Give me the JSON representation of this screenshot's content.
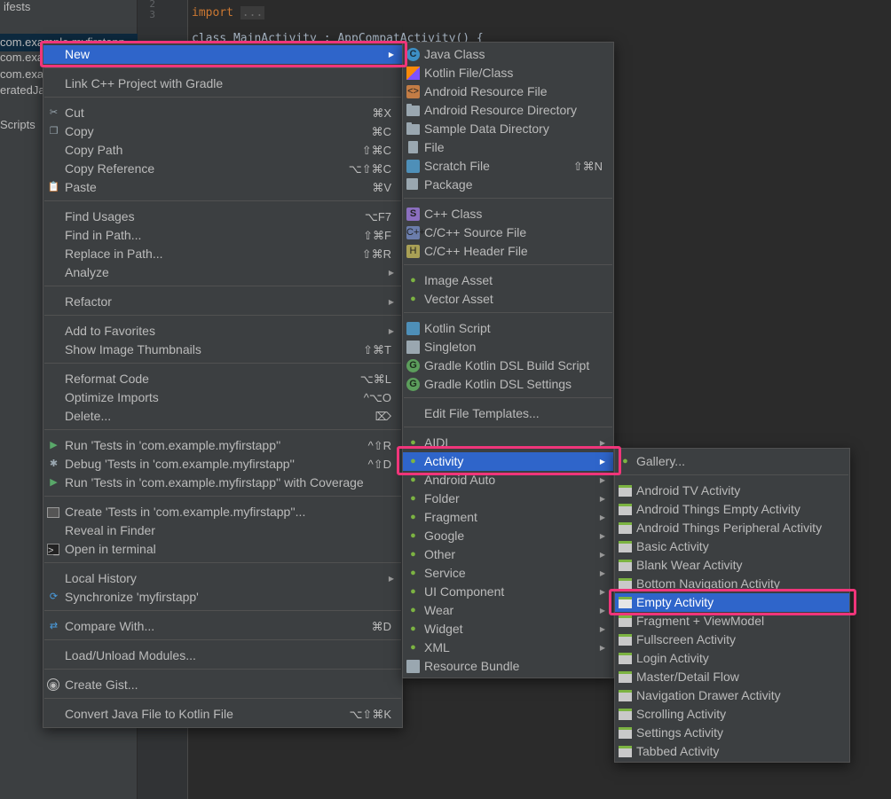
{
  "project_pane": {
    "items": [
      "ifests",
      "com.example.myfirstapp",
      "com.example",
      "com.example",
      "eratedJava",
      "Scripts"
    ]
  },
  "editor": {
    "line_numbers": [
      "2",
      "3"
    ],
    "import_keyword": "import",
    "import_fold": "...",
    "line4_text": "class MainActivity : AppCompatActivity() {"
  },
  "main_menu": {
    "new": "New",
    "link_cpp": "Link C++ Project with Gradle",
    "cut": "Cut",
    "cut_sc": "⌘X",
    "copy": "Copy",
    "copy_sc": "⌘C",
    "copy_path": "Copy Path",
    "copy_path_sc": "⇧⌘C",
    "copy_ref": "Copy Reference",
    "copy_ref_sc": "⌥⇧⌘C",
    "paste": "Paste",
    "paste_sc": "⌘V",
    "find_usages": "Find Usages",
    "find_usages_sc": "⌥F7",
    "find_in_path": "Find in Path...",
    "find_in_path_sc": "⇧⌘F",
    "replace_in_path": "Replace in Path...",
    "replace_in_path_sc": "⇧⌘R",
    "analyze": "Analyze",
    "refactor": "Refactor",
    "add_favorites": "Add to Favorites",
    "show_thumbs": "Show Image Thumbnails",
    "show_thumbs_sc": "⇧⌘T",
    "reformat": "Reformat Code",
    "reformat_sc": "⌥⌘L",
    "optimize": "Optimize Imports",
    "optimize_sc": "^⌥O",
    "delete": "Delete...",
    "delete_sc": "⌦",
    "run_tests": "Run 'Tests in 'com.example.myfirstapp''",
    "run_tests_sc": "^⇧R",
    "debug_tests": "Debug 'Tests in 'com.example.myfirstapp''",
    "debug_tests_sc": "^⇧D",
    "run_coverage": "Run 'Tests in 'com.example.myfirstapp'' with Coverage",
    "create_tests": "Create 'Tests in 'com.example.myfirstapp''...",
    "reveal_finder": "Reveal in Finder",
    "open_terminal": "Open in terminal",
    "local_history": "Local History",
    "synchronize": "Synchronize 'myfirstapp'",
    "compare_with": "Compare With...",
    "compare_with_sc": "⌘D",
    "load_unload": "Load/Unload Modules...",
    "create_gist": "Create Gist...",
    "convert_kotlin": "Convert Java File to Kotlin File",
    "convert_kotlin_sc": "⌥⇧⌘K"
  },
  "new_menu": {
    "java_class": "Java Class",
    "kotlin_file": "Kotlin File/Class",
    "android_res_file": "Android Resource File",
    "android_res_dir": "Android Resource Directory",
    "sample_data_dir": "Sample Data Directory",
    "file": "File",
    "scratch_file": "Scratch File",
    "scratch_file_sc": "⇧⌘N",
    "package": "Package",
    "cpp_class": "C++ Class",
    "cpp_source": "C/C++ Source File",
    "cpp_header": "C/C++ Header File",
    "image_asset": "Image Asset",
    "vector_asset": "Vector Asset",
    "kotlin_script": "Kotlin Script",
    "singleton": "Singleton",
    "gradle_build": "Gradle Kotlin DSL Build Script",
    "gradle_settings": "Gradle Kotlin DSL Settings",
    "edit_templates": "Edit File Templates...",
    "aidl": "AIDL",
    "activity": "Activity",
    "android_auto": "Android Auto",
    "folder": "Folder",
    "fragment": "Fragment",
    "google": "Google",
    "other": "Other",
    "service": "Service",
    "ui_component": "UI Component",
    "wear": "Wear",
    "widget": "Widget",
    "xml": "XML",
    "resource_bundle": "Resource Bundle"
  },
  "activity_menu": {
    "gallery": "Gallery...",
    "items": [
      "Android TV Activity",
      "Android Things Empty Activity",
      "Android Things Peripheral Activity",
      "Basic Activity",
      "Blank Wear Activity",
      "Bottom Navigation Activity",
      "Empty Activity",
      "Fragment + ViewModel",
      "Fullscreen Activity",
      "Login Activity",
      "Master/Detail Flow",
      "Navigation Drawer Activity",
      "Scrolling Activity",
      "Settings Activity",
      "Tabbed Activity"
    ]
  },
  "colors": {
    "selection": "#2f65ca",
    "highlight_border": "#f0357a",
    "menu_bg": "#3c3f41"
  }
}
